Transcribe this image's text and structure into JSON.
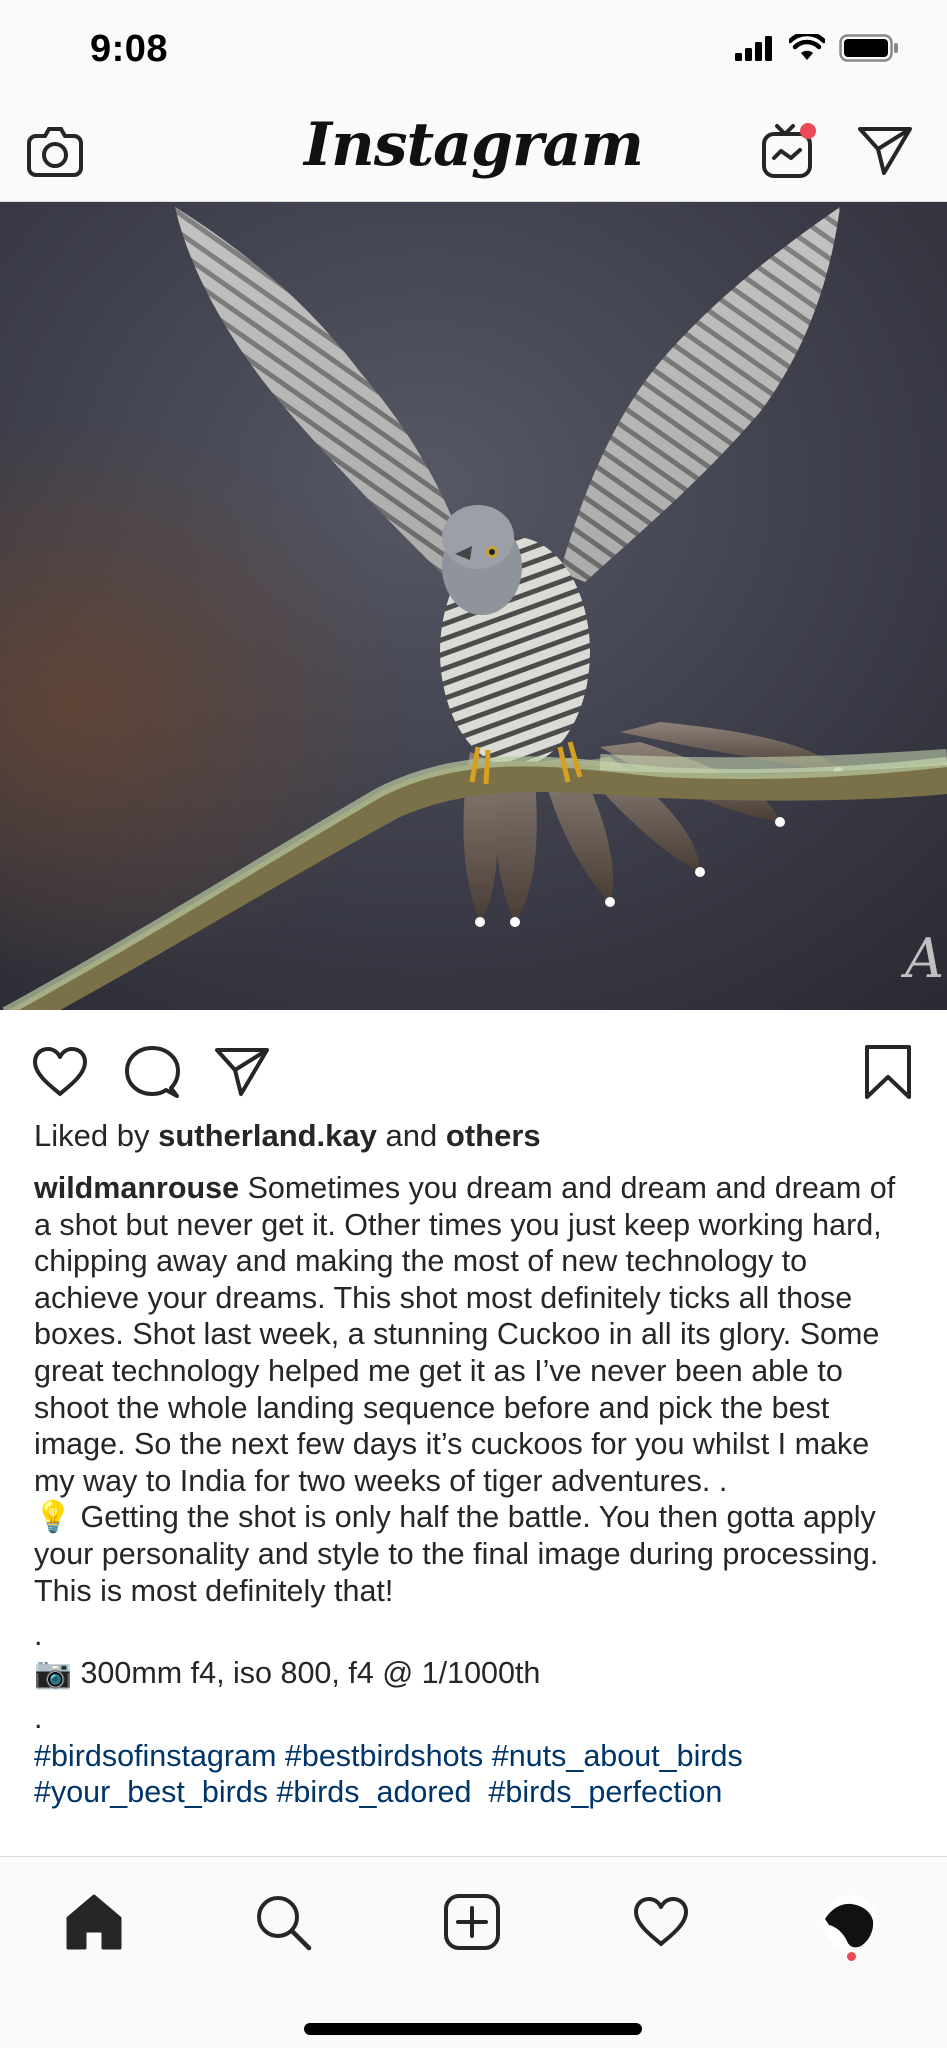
{
  "status_bar": {
    "time": "9:08",
    "icons": [
      "cellular-signal-icon",
      "wifi-icon",
      "battery-icon"
    ]
  },
  "header": {
    "logo": "Instagram",
    "icons": [
      "camera-icon",
      "igtv-icon",
      "direct-message-icon"
    ],
    "notification_color": "#ed4956"
  },
  "post": {
    "image_description": "",
    "watermark": "A",
    "actions": [
      "heart-icon",
      "comment-icon",
      "share-icon",
      "bookmark-icon"
    ],
    "liked_by_prefix": "Liked by",
    "liked_by_user": "sutherland.kay",
    "liked_by_and": "and",
    "liked_by_others": "others",
    "username": "wildmanrouse",
    "caption_text": "Sometimes you dream and dream and dream of a shot but never get it. Other times you just keep working hard, chipping away and making the most of new technology to achieve your dreams. This shot most definitely ticks all those boxes. Shot last week, a stunning Cuckoo in all its glory. Some great technology helped me get it as I’ve never been able to shoot the whole landing sequence before and pick the best image. So the next few days it’s cuckoos for you whilst I make my way to India for two weeks of tiger adventures. .",
    "tip_emoji": "💡",
    "tip_text": "Getting the shot is only half the battle. You then gotta apply your personality and style to the final image during processing. This is most definitely that!",
    "dot1": ".",
    "camera_emoji": "📷",
    "camera_settings": "300mm f4, iso 800, f4 @ 1/1000th",
    "dot2": ".",
    "hashtags_line1": "#birdsofinstagram #bestbirdshots #nuts_about_birds",
    "hashtags_line2": "#your_best_birds #birds_adored  #birds_perfection",
    "hashtag_color": "#003569"
  },
  "tab_bar": {
    "tabs": [
      "home-icon",
      "search-icon",
      "new-post-icon",
      "activity-icon",
      "profile-icon"
    ],
    "active": "home-icon"
  }
}
